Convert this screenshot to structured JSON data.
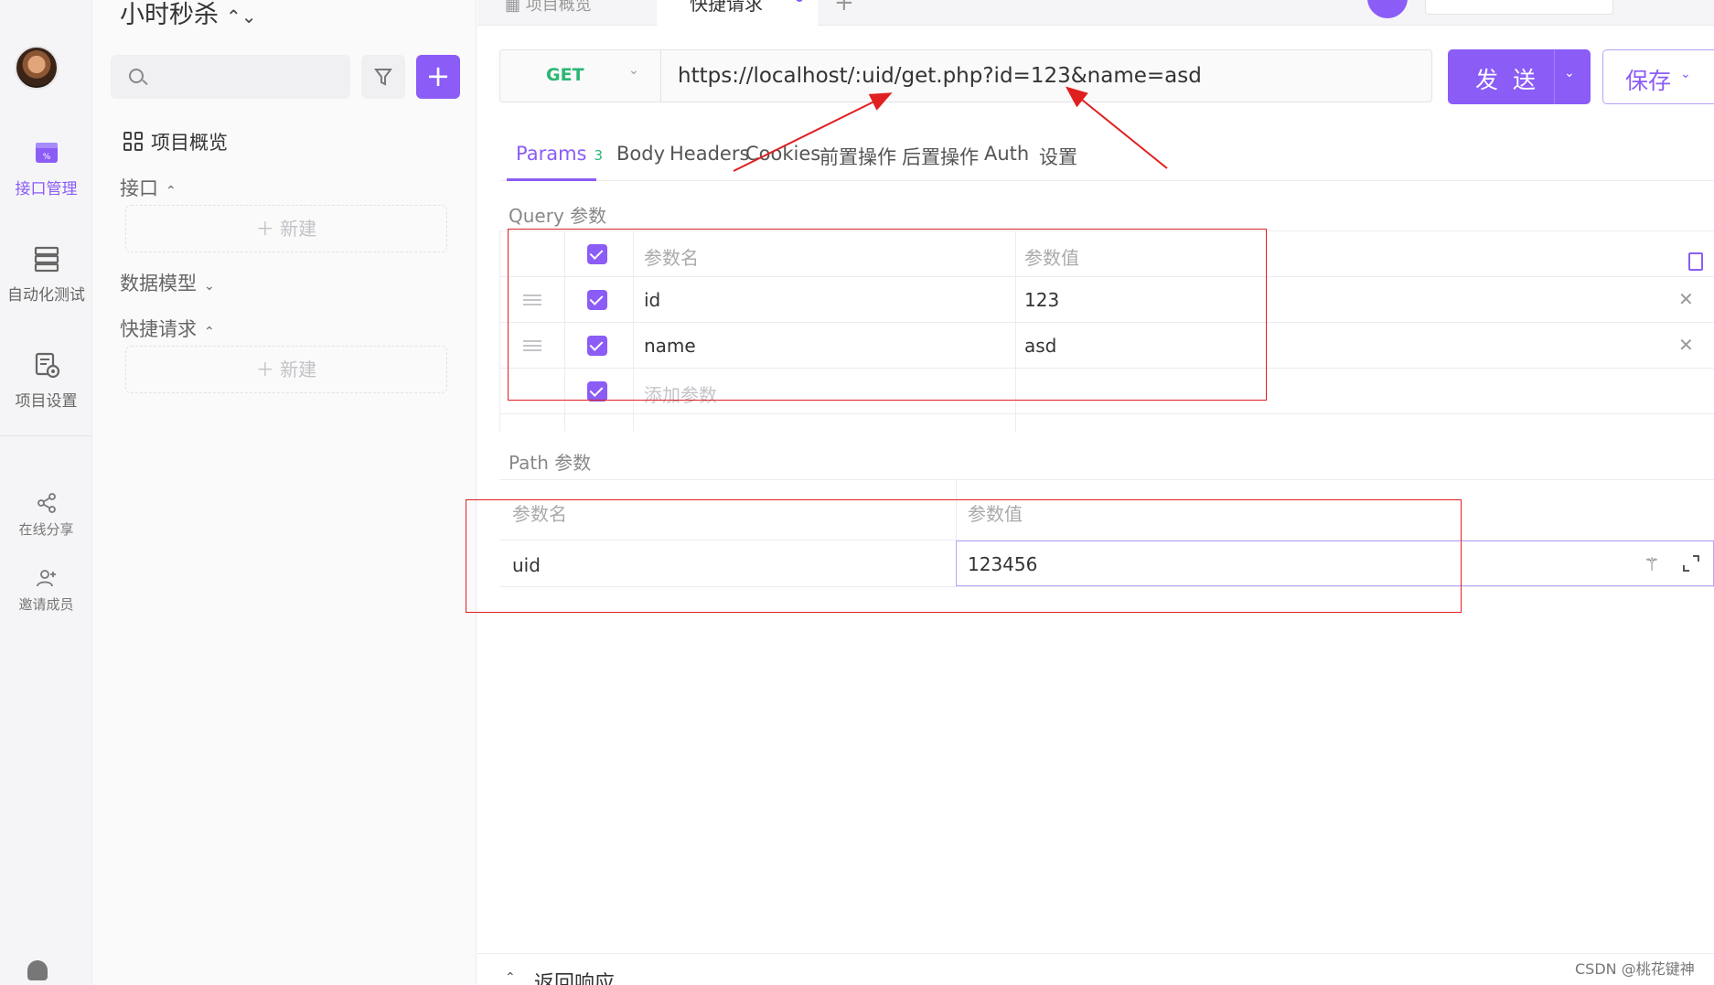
{
  "rail": {
    "items": [
      {
        "label": "接口管理",
        "icon": "api-management-icon",
        "active": true
      },
      {
        "label": "自动化测试",
        "icon": "automation-test-icon",
        "active": false
      },
      {
        "label": "项目设置",
        "icon": "project-settings-icon",
        "active": false
      }
    ],
    "bottom": [
      {
        "label": "在线分享",
        "icon": "share-icon"
      },
      {
        "label": "邀请成员",
        "icon": "invite-member-icon"
      }
    ]
  },
  "tree": {
    "project_name": "小时秒杀",
    "overview": "项目概览",
    "sections": [
      {
        "label": "接口",
        "expanded": true,
        "new_label": "新建"
      },
      {
        "label": "数据模型",
        "expanded": false
      },
      {
        "label": "快捷请求",
        "expanded": true,
        "new_label": "新建"
      }
    ]
  },
  "tabs": {
    "items": [
      "项目概览",
      "快捷请求"
    ],
    "active": "快捷请求"
  },
  "request": {
    "method": "GET",
    "url": "https://localhost/:uid/get.php?id=123&name=asd",
    "send_label": "发 送",
    "save_label": "保存"
  },
  "subtabs": {
    "params_label": "Params",
    "params_count": "3",
    "items": [
      "Body",
      "Headers",
      "Cookies",
      "前置操作",
      "后置操作",
      "Auth",
      "设置"
    ]
  },
  "query": {
    "label": "Query 参数",
    "header_name": "参数名",
    "header_value": "参数值",
    "rows": [
      {
        "name": "id",
        "value": "123",
        "checked": true
      },
      {
        "name": "name",
        "value": "asd",
        "checked": true
      }
    ],
    "add_placeholder": "添加参数"
  },
  "path": {
    "label": "Path 参数",
    "header_name": "参数名",
    "header_value": "参数值",
    "rows": [
      {
        "name": "uid",
        "value": "123456"
      }
    ]
  },
  "response": {
    "label": "返回响应"
  },
  "watermark": "CSDN @桃花键神",
  "colors": {
    "accent": "#8b5cf6",
    "method_get": "#2bb673",
    "annotation": "#e02020"
  }
}
